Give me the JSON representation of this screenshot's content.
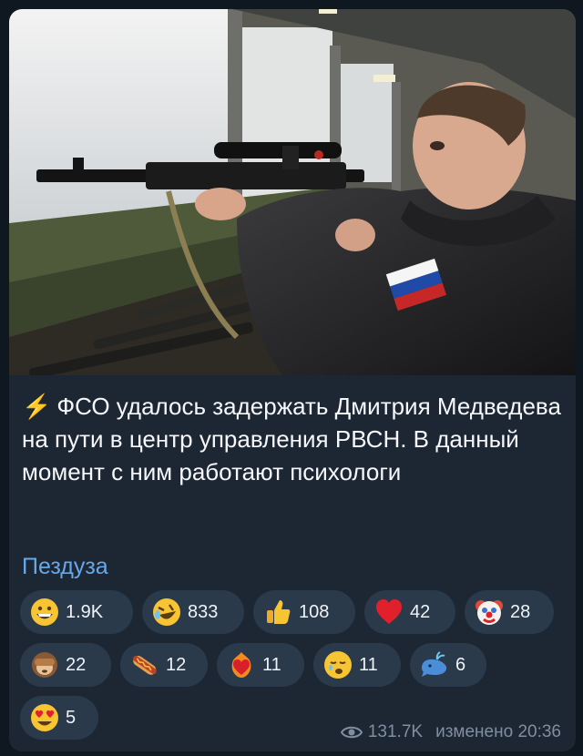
{
  "post": {
    "text": "ФСО удалось задержать Дмитрия Медведева на пути в центр управления РВСН. В данный момент с ним работают психологи",
    "bolt_icon": "⚡",
    "signature": "Пездуза"
  },
  "reactions": [
    {
      "emoji": "grinning-face",
      "count": "1.9K"
    },
    {
      "emoji": "rolling-laughing-face",
      "count": "833"
    },
    {
      "emoji": "thumbs-up",
      "count": "108"
    },
    {
      "emoji": "red-heart",
      "count": "42"
    },
    {
      "emoji": "clown-face",
      "count": "28"
    },
    {
      "emoji": "see-no-evil-monkey",
      "count": "22"
    },
    {
      "emoji": "hot-dog",
      "count": "12"
    },
    {
      "emoji": "heart-on-fire",
      "count": "11"
    },
    {
      "emoji": "sleepy-face",
      "count": "11"
    },
    {
      "emoji": "whale",
      "count": "6"
    },
    {
      "emoji": "heart-eyes-face",
      "count": "5"
    }
  ],
  "meta": {
    "views": "131.7K",
    "edited_time": "изменено 20:36"
  },
  "colors": {
    "bubble": "#1d2733",
    "link": "#66a8e8",
    "chip": "#2a3a4b"
  }
}
